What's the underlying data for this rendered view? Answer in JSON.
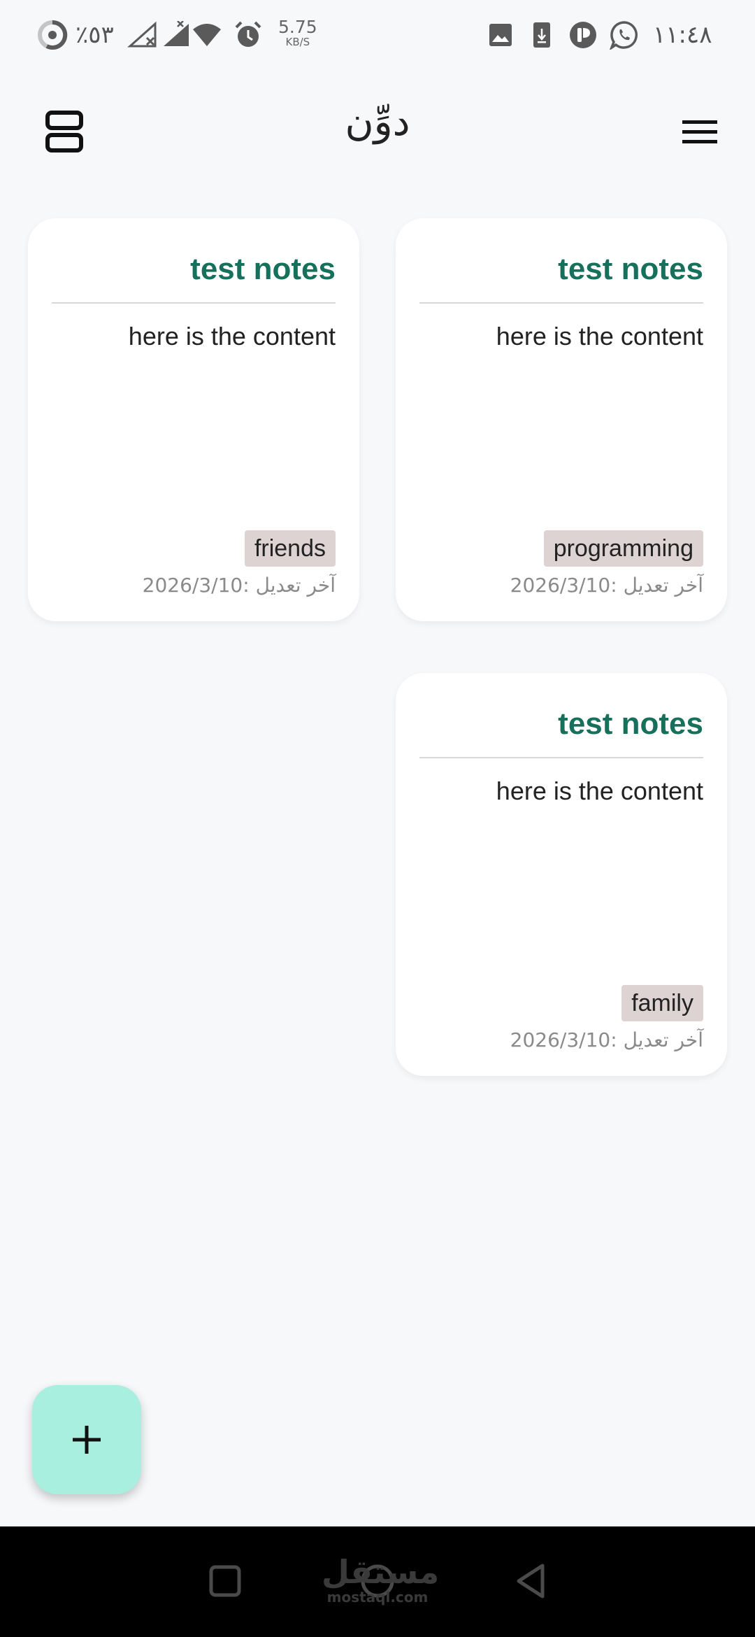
{
  "status_bar": {
    "battery": "٪٥٣",
    "net_speed_value": "5.75",
    "net_speed_unit": "KB/S",
    "time": "١١:٤٨"
  },
  "app_bar": {
    "title": "دوِّن",
    "layout_icon": "stacked-rows-icon",
    "menu_icon": "hamburger-menu-icon"
  },
  "notes": [
    {
      "title": "test notes",
      "content": "here is the content",
      "tag": "friends",
      "date": "2026/3/10: آخر تعديل"
    },
    {
      "title": "test notes",
      "content": "here is the content",
      "tag": "programming",
      "date": "2026/3/10: آخر تعديل"
    },
    {
      "title": "test notes",
      "content": "here is the content",
      "tag": "family",
      "date": "2026/3/10: آخر تعديل"
    }
  ],
  "fab": {
    "icon": "plus-icon"
  },
  "watermark": {
    "arabic": "مستقل",
    "latin": "mostaql.com"
  },
  "colors": {
    "note_title": "#16705c",
    "fab_background": "#a8efe0",
    "tag_background": "#ded3d3",
    "page_background": "#f7f8fa"
  }
}
